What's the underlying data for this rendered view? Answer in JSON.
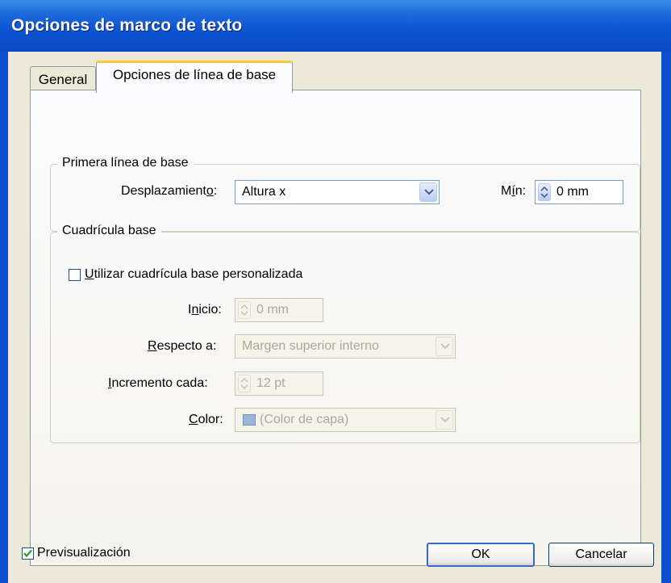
{
  "window": {
    "title": "Opciones de marco de texto"
  },
  "tabs": {
    "general": "General",
    "baseline": "Opciones de línea de base"
  },
  "first_baseline": {
    "legend": "Primera línea de base",
    "offset_label": "Desplazamiento:",
    "offset_value": "Altura x",
    "min_label": "Mín:",
    "min_value": "0 mm"
  },
  "baseline_grid": {
    "legend": "Cuadrícula base",
    "use_custom_label": "Utilizar cuadrícula base personalizada",
    "use_custom_checked": false,
    "start_label": "Inicio:",
    "start_value": "0 mm",
    "relative_label": "Respecto a:",
    "relative_value": "Margen superior interno",
    "increment_label": "Incremento cada:",
    "increment_value": "12 pt",
    "color_label": "Color:",
    "color_value": "(Color de capa)",
    "color_swatch": "#9db5d9"
  },
  "footer": {
    "preview_label": "Previsualización",
    "preview_checked": true,
    "ok": "OK",
    "cancel": "Cancelar"
  }
}
